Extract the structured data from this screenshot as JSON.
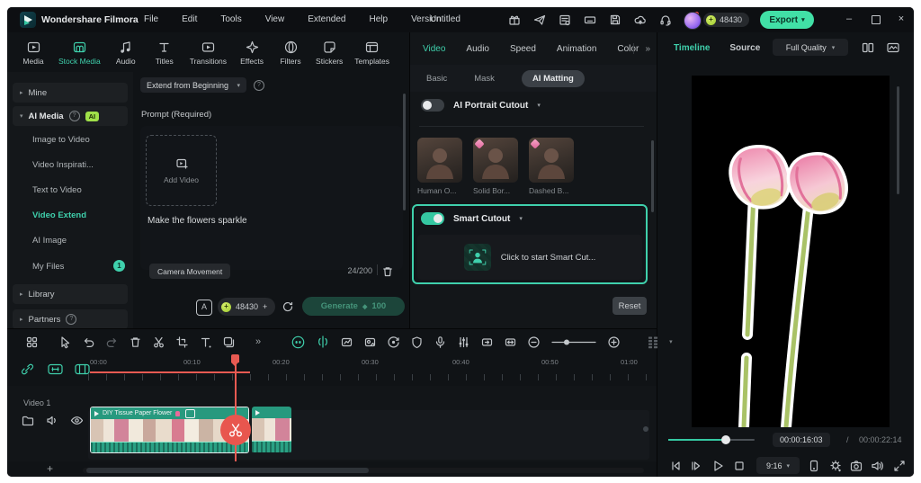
{
  "titlebar": {
    "app_name": "Wondershare Filmora",
    "menus": [
      "File",
      "Edit",
      "Tools",
      "View",
      "Extended",
      "Help",
      "Version"
    ],
    "document_title": "Untitled",
    "coin_count": "48430",
    "export_label": "Export"
  },
  "media_toolbar": {
    "items": [
      {
        "label": "Media"
      },
      {
        "label": "Stock Media",
        "active": true
      },
      {
        "label": "Audio"
      },
      {
        "label": "Titles"
      },
      {
        "label": "Transitions"
      },
      {
        "label": "Effects"
      },
      {
        "label": "Filters"
      },
      {
        "label": "Stickers"
      },
      {
        "label": "Templates"
      }
    ]
  },
  "sidebar": {
    "items": [
      {
        "label": "Mine"
      },
      {
        "label": "AI Media",
        "badge": "AI"
      },
      {
        "label": "Image to Video"
      },
      {
        "label": "Video Inspirati..."
      },
      {
        "label": "Text to Video"
      },
      {
        "label": "Video Extend",
        "active": true
      },
      {
        "label": "AI Image"
      },
      {
        "label": "My Files",
        "count": "1"
      },
      {
        "label": "Library"
      },
      {
        "label": "Partners"
      }
    ]
  },
  "prompt_panel": {
    "mode_dropdown": "Extend from Beginning",
    "prompt_label": "Prompt (Required)",
    "add_video_label": "Add Video",
    "prompt_text": "Make the flowers sparkle",
    "camera_movement_label": "Camera Movement",
    "char_counter": "24/200",
    "coin_count": "48430",
    "coin_plus": "+",
    "generate_label": "Generate",
    "generate_cost": "100"
  },
  "properties_panel": {
    "tabs": [
      "Video",
      "Audio",
      "Speed",
      "Animation",
      "Color"
    ],
    "subtabs": [
      "Basic",
      "Mask",
      "AI Matting"
    ],
    "portrait_toggle_label": "AI Portrait Cutout",
    "presets": [
      "Human O...",
      "Solid Bor...",
      "Dashed B..."
    ],
    "smart_cutout_label": "Smart Cutout",
    "smart_cutout_button": "Click to start Smart Cut...",
    "reset_label": "Reset"
  },
  "preview_panel": {
    "tabs": [
      "Timeline",
      "Source"
    ],
    "quality": "Full Quality",
    "current_time": "00:00:16:03",
    "time_separator": "/",
    "total_time": "00:00:22:14",
    "ratio": "9:16"
  },
  "timeline": {
    "ruler": [
      "00:00",
      "00:10",
      "00:20",
      "00:30",
      "00:40",
      "00:50",
      "01:00"
    ],
    "track_label": "Video 1",
    "clip_title": "DIY Tissue Paper Flower"
  },
  "colors": {
    "accent_teal": "#3fd0ac",
    "export_green": "#41e0a6",
    "playhead_red": "#e85a52",
    "clip_teal": "#27997e",
    "coin_green": "#a6d930"
  }
}
